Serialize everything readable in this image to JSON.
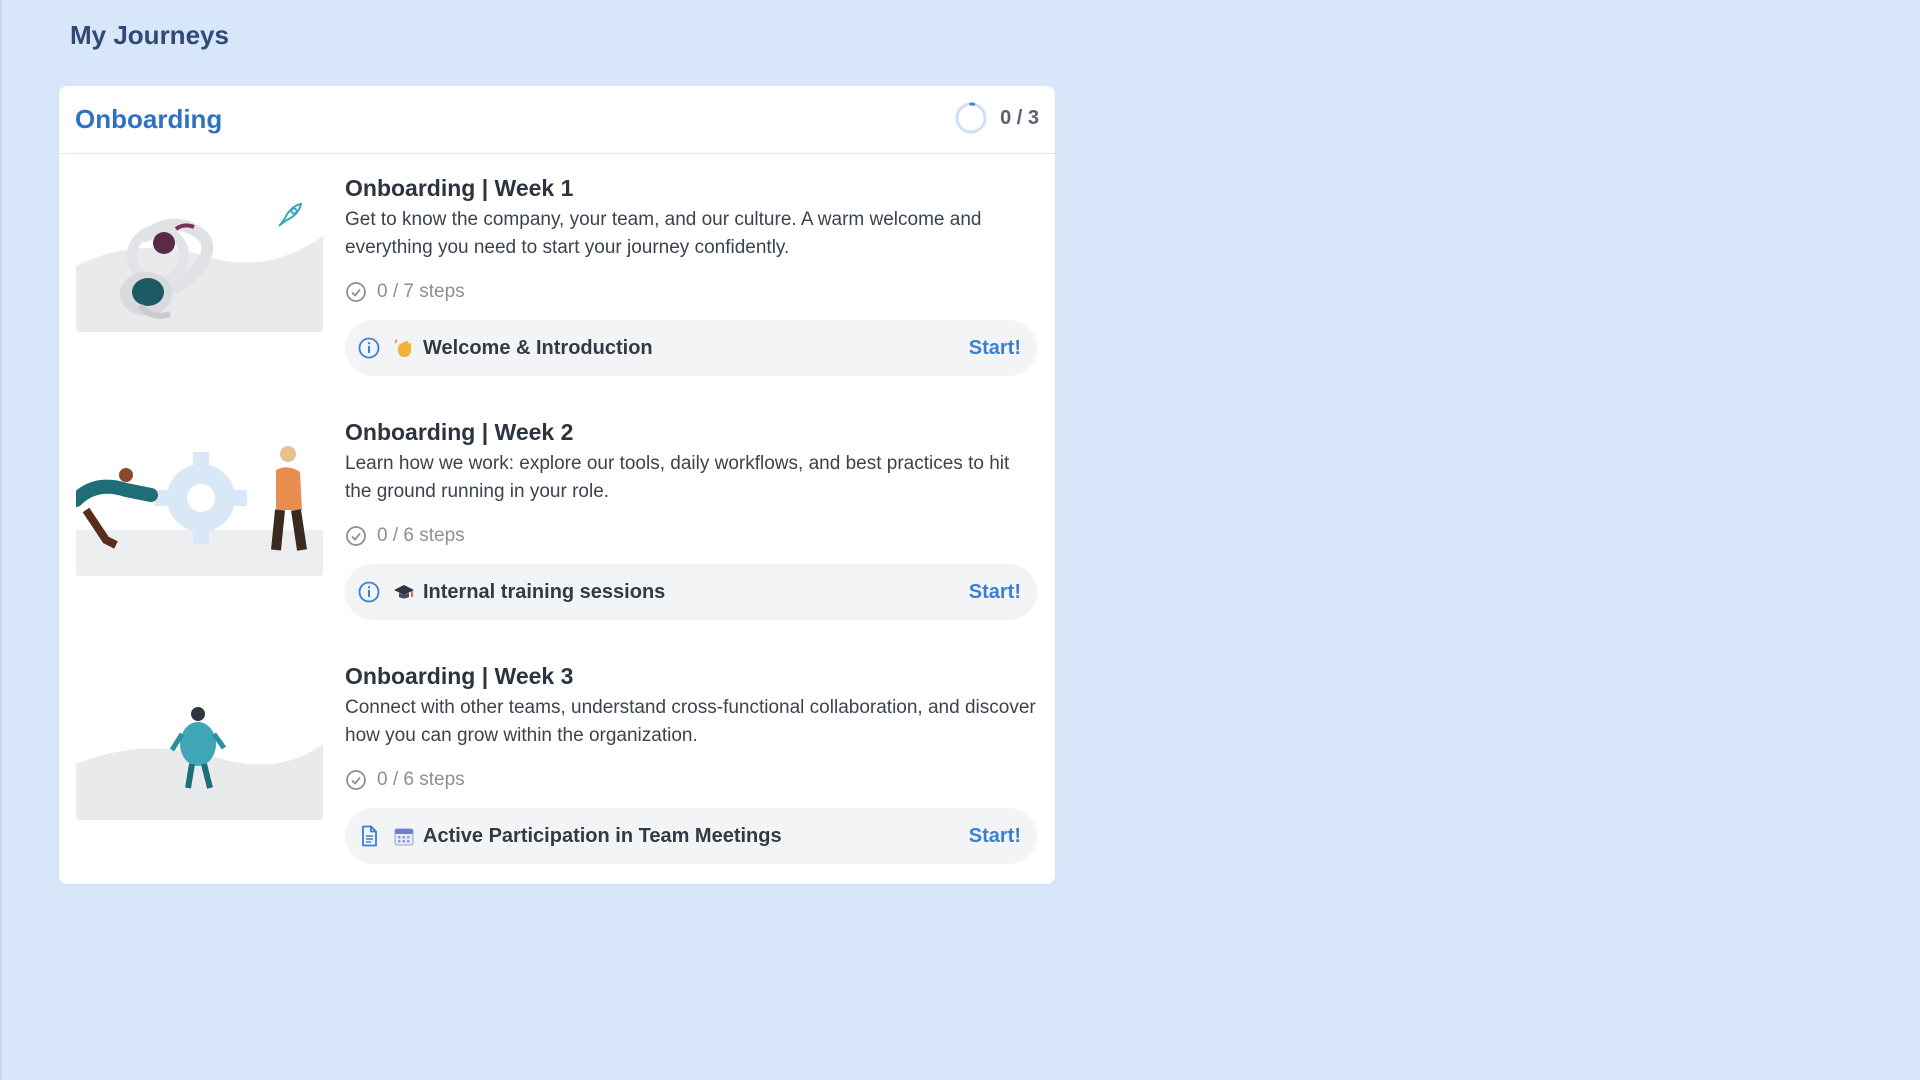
{
  "page": {
    "title": "My Journeys"
  },
  "journey_group": {
    "title": "Onboarding",
    "progress_text": "0 / 3",
    "progress_fraction": 0.0
  },
  "journeys": [
    {
      "title": "Onboarding | Week 1",
      "description": "Get to know the company, your team, and our culture. A warm welcome and everything you need to start your journey confidently.",
      "steps": "0 / 7 steps",
      "next_step": {
        "type_icon": "info-icon",
        "emoji_icon": "waving-hand-icon",
        "label": "Welcome & Introduction",
        "action": "Start!"
      },
      "badge_icon": "rocket-icon"
    },
    {
      "title": "Onboarding | Week 2",
      "description": "Learn how we work: explore our tools, daily workflows, and best practices to hit the ground running in your role.",
      "steps": "0 / 6 steps",
      "next_step": {
        "type_icon": "info-icon",
        "emoji_icon": "graduation-cap-icon",
        "label": "Internal training sessions",
        "action": "Start!"
      }
    },
    {
      "title": "Onboarding | Week 3",
      "description": "Connect with other teams, understand cross-functional collaboration, and discover how you can grow within the organization.",
      "steps": "0 / 6 steps",
      "next_step": {
        "type_icon": "document-icon",
        "emoji_icon": "calendar-icon",
        "label": "Active Participation in Team Meetings",
        "action": "Start!"
      }
    }
  ],
  "colors": {
    "background": "#d7e6f8",
    "accent": "#2f72c4",
    "link": "#3a7fd4"
  }
}
